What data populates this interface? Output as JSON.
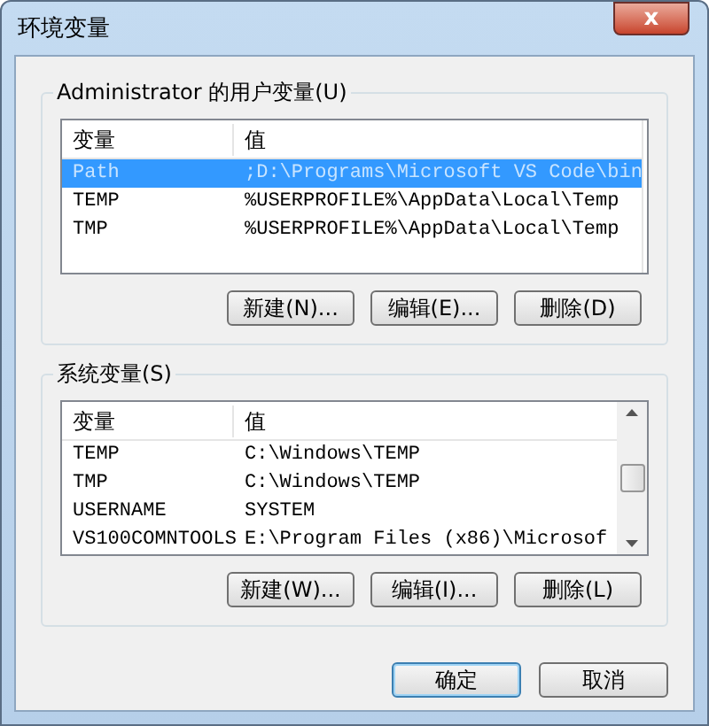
{
  "window": {
    "title": "环境变量",
    "close": "x"
  },
  "user_vars": {
    "title": "Administrator 的用户变量(U)",
    "columns": [
      "变量",
      "值"
    ],
    "rows": [
      {
        "name": "Path",
        "value": ";D:\\Programs\\Microsoft VS Code\\bin",
        "selected": true
      },
      {
        "name": "TEMP",
        "value": "%USERPROFILE%\\AppData\\Local\\Temp",
        "selected": false
      },
      {
        "name": "TMP",
        "value": "%USERPROFILE%\\AppData\\Local\\Temp",
        "selected": false
      }
    ],
    "buttons": [
      "新建(N)...",
      "编辑(E)...",
      "删除(D)"
    ]
  },
  "system_vars": {
    "title": "系统变量(S)",
    "columns": [
      "变量",
      "值"
    ],
    "rows": [
      {
        "name": "TEMP",
        "value": "C:\\Windows\\TEMP",
        "selected": false
      },
      {
        "name": "TMP",
        "value": "C:\\Windows\\TEMP",
        "selected": false
      },
      {
        "name": "USERNAME",
        "value": "SYSTEM",
        "selected": false
      },
      {
        "name": "VS100COMNTOOLS",
        "value": "E:\\Program Files (x86)\\Microsof",
        "selected": false
      }
    ],
    "buttons": [
      "新建(W)...",
      "编辑(I)...",
      "删除(L)"
    ]
  },
  "footer_buttons": [
    {
      "label": "确定",
      "kind": "default"
    },
    {
      "label": "取消",
      "kind": "normal"
    }
  ]
}
